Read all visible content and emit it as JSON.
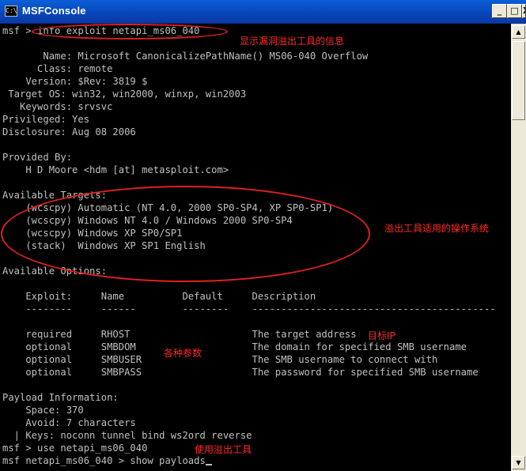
{
  "window": {
    "title": "MSFConsole",
    "icon": "console-icon",
    "icon_glyph": "C:\\",
    "buttons": {
      "minimize": "_",
      "maximize": "□",
      "close": "X"
    }
  },
  "console": {
    "lines": [
      "msf > info exploit netapi_ms06_040",
      "",
      "       Name: Microsoft CanonicalizePathName() MS06-040 Overflow",
      "      Class: remote",
      "    Version: $Rev: 3819 $",
      " Target OS: win32, win2000, winxp, win2003",
      "   Keywords: srvsvc",
      "Privileged: Yes",
      "Disclosure: Aug 08 2006",
      "",
      "Provided By:",
      "    H D Moore <hdm [at] metasploit.com>",
      "",
      "Available Targets:",
      "    (wcscpy) Automatic (NT 4.0, 2000 SP0-SP4, XP SP0-SP1)",
      "    (wcscpy) Windows NT 4.0 / Windows 2000 SP0-SP4",
      "    (wcscpy) Windows XP SP0/SP1",
      "    (stack)  Windows XP SP1 English",
      "",
      "Available Options:",
      "",
      "    Exploit:     Name          Default     Description",
      "    --------     ------        --------    ------------------------------------------",
      "",
      "    required     RHOST                     The target address",
      "    optional     SMBDOM                    The domain for specified SMB username",
      "    optional     SMBUSER                   The SMB username to connect with",
      "    optional     SMBPASS                   The password for specified SMB username",
      "",
      "Payload Information:",
      "    Space: 370",
      "    Avoid: 7 characters",
      "  | Keys: noconn tunnel bind ws2ord reverse",
      "msf > use netapi_ms06_040",
      "msf netapi_ms06_040 > show payloads"
    ]
  },
  "annotations": {
    "info": "显示漏洞溢出工具的信息",
    "targets": "溢出工具适用的操作系统",
    "target_ip": "目标IP",
    "params": "各种参数",
    "use_tool": "使用溢出工具"
  },
  "colors": {
    "console_bg": "#000000",
    "console_text": "#c0c0c0",
    "titlebar": "#0a5fd8",
    "annotation": "#ff2a2a"
  }
}
